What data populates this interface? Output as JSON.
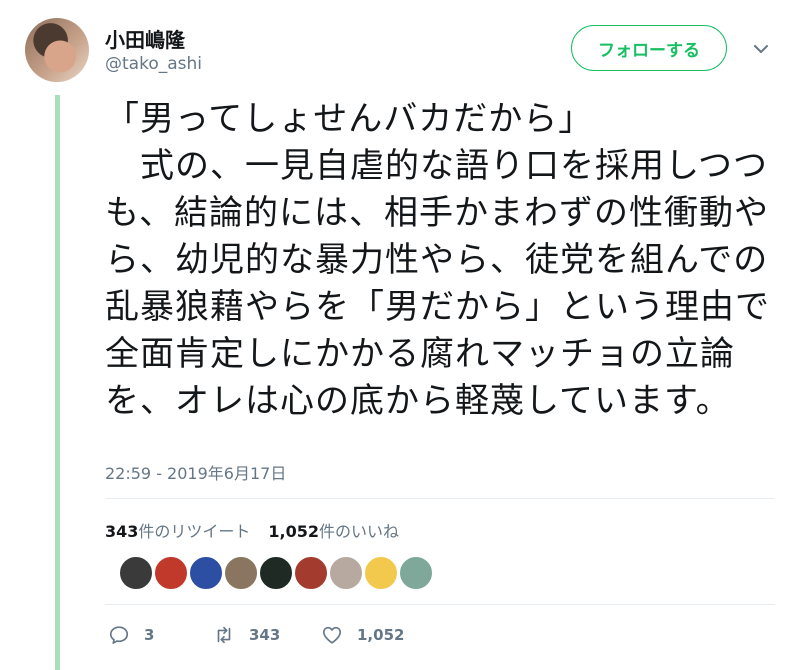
{
  "user": {
    "display_name": "小田嶋隆",
    "handle": "@tako_ashi",
    "follow_label": "フォローする"
  },
  "tweet": {
    "text": "「男ってしょせんバカだから」\n　式の、一見自虐的な語り口を採用しつつも、結論的には、相手かまわずの性衝動やら、幼児的な暴力性やら、徒党を組んでの乱暴狼藉やらを「男だから」という理由で全面肯定しにかかる腐れマッチョの立論を、オレは心の底から軽蔑しています。",
    "timestamp": "22:59 - 2019年6月17日"
  },
  "stats": {
    "retweets_count": "343",
    "retweets_label": "件のリツイート",
    "likes_count": "1,052",
    "likes_label": "件のいいね"
  },
  "likers": [
    {
      "color": "#3a3a3a"
    },
    {
      "color": "#c0392b"
    },
    {
      "color": "#2c4fa3"
    },
    {
      "color": "#8a7560"
    },
    {
      "color": "#1f2a24"
    },
    {
      "color": "#a33b2e"
    },
    {
      "color": "#b7a9a0"
    },
    {
      "color": "#f2c94c"
    },
    {
      "color": "#7fa89a"
    }
  ],
  "actions": {
    "replies": "3",
    "retweets": "343",
    "likes": "1,052"
  },
  "colors": {
    "accent": "#17bf63",
    "thread_line": "#a8e0bd",
    "muted": "#657786"
  }
}
